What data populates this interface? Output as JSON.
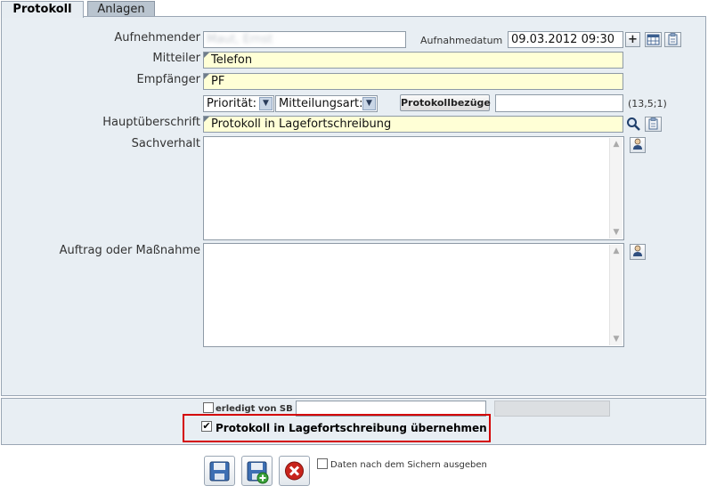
{
  "tabs": [
    {
      "label": "Protokoll"
    },
    {
      "label": "Anlagen"
    }
  ],
  "form": {
    "aufnehmender": {
      "label": "Aufnehmender",
      "value": "Maut, Ernst"
    },
    "aufnahmedatum": {
      "label": "Aufnahmedatum",
      "value": "09.03.2012 09:30"
    },
    "mitteiler": {
      "label": "Mitteiler",
      "value": "Telefon"
    },
    "empfaenger": {
      "label": "Empfänger",
      "value": "PF"
    },
    "prioritaet": {
      "value": "Priorität:"
    },
    "mitteilungsart": {
      "value": "Mitteilungsart:"
    },
    "protokollbezuege": {
      "label": "Protokollbezüge",
      "value": "",
      "code": "(13,5;1)"
    },
    "hauptueberschrift": {
      "label": "Hauptüberschrift",
      "value": "Protokoll in Lagefortschreibung"
    },
    "sachverhalt": {
      "label": "Sachverhalt",
      "value": ""
    },
    "auftrag": {
      "label": "Auftrag oder Maßnahme",
      "value": ""
    }
  },
  "bottom": {
    "erledigt": {
      "label": "erledigt von SB",
      "checked": false,
      "value": ""
    },
    "uebernehmen": {
      "label": "Protokoll in Lagefortschreibung übernehmen",
      "checked": true
    },
    "highlight_color": "#d40000"
  },
  "footer": {
    "daten_ausgeben": {
      "label": "Daten nach dem Sichern ausgeben",
      "checked": false
    }
  },
  "icons": {
    "plus": "+",
    "calendar": "calendar-icon",
    "clipboard": "clipboard-icon",
    "search": "search-icon",
    "person": "person-icon",
    "save": "save-icon",
    "save_new": "save-new-icon",
    "cancel": "cancel-icon"
  }
}
